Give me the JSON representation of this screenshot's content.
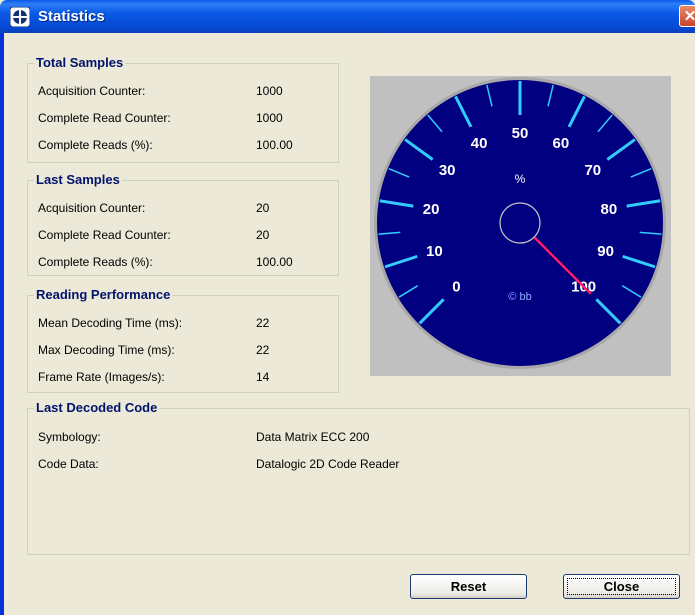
{
  "window": {
    "title": "Statistics",
    "close_glyph": "✕"
  },
  "total_samples": {
    "title": "Total Samples",
    "rows": [
      {
        "label": "Acquisition Counter:",
        "value": "1000"
      },
      {
        "label": "Complete Read Counter:",
        "value": "1000"
      },
      {
        "label": "Complete Reads (%):",
        "value": "100.00"
      }
    ]
  },
  "last_samples": {
    "title": "Last Samples",
    "rows": [
      {
        "label": "Acquisition Counter:",
        "value": "20"
      },
      {
        "label": "Complete Read Counter:",
        "value": "20"
      },
      {
        "label": "Complete Reads (%):",
        "value": "100.00"
      }
    ]
  },
  "reading_performance": {
    "title": "Reading Performance",
    "rows": [
      {
        "label": "Mean Decoding Time (ms):",
        "value": "22"
      },
      {
        "label": "Max Decoding Time (ms):",
        "value": "22"
      },
      {
        "label": "Frame Rate (Images/s):",
        "value": "14"
      }
    ]
  },
  "last_decoded": {
    "title": "Last Decoded Code",
    "rows": [
      {
        "label": "Symbology:",
        "value": "Data Matrix ECC 200"
      },
      {
        "label": "Code Data:",
        "value": "Datalogic 2D Code Reader"
      }
    ]
  },
  "gauge": {
    "unit_label": "%",
    "brand_label": "© bb",
    "scale_labels": [
      "0",
      "10",
      "20",
      "30",
      "40",
      "50",
      "60",
      "70",
      "80",
      "90",
      "100"
    ],
    "min": 0,
    "max": 100,
    "value": 100,
    "dial_color": "#000080",
    "tick_color": "#33ccff",
    "needle_color": "#ff1a66"
  },
  "buttons": {
    "reset_label": "Reset",
    "close_label": "Close"
  }
}
